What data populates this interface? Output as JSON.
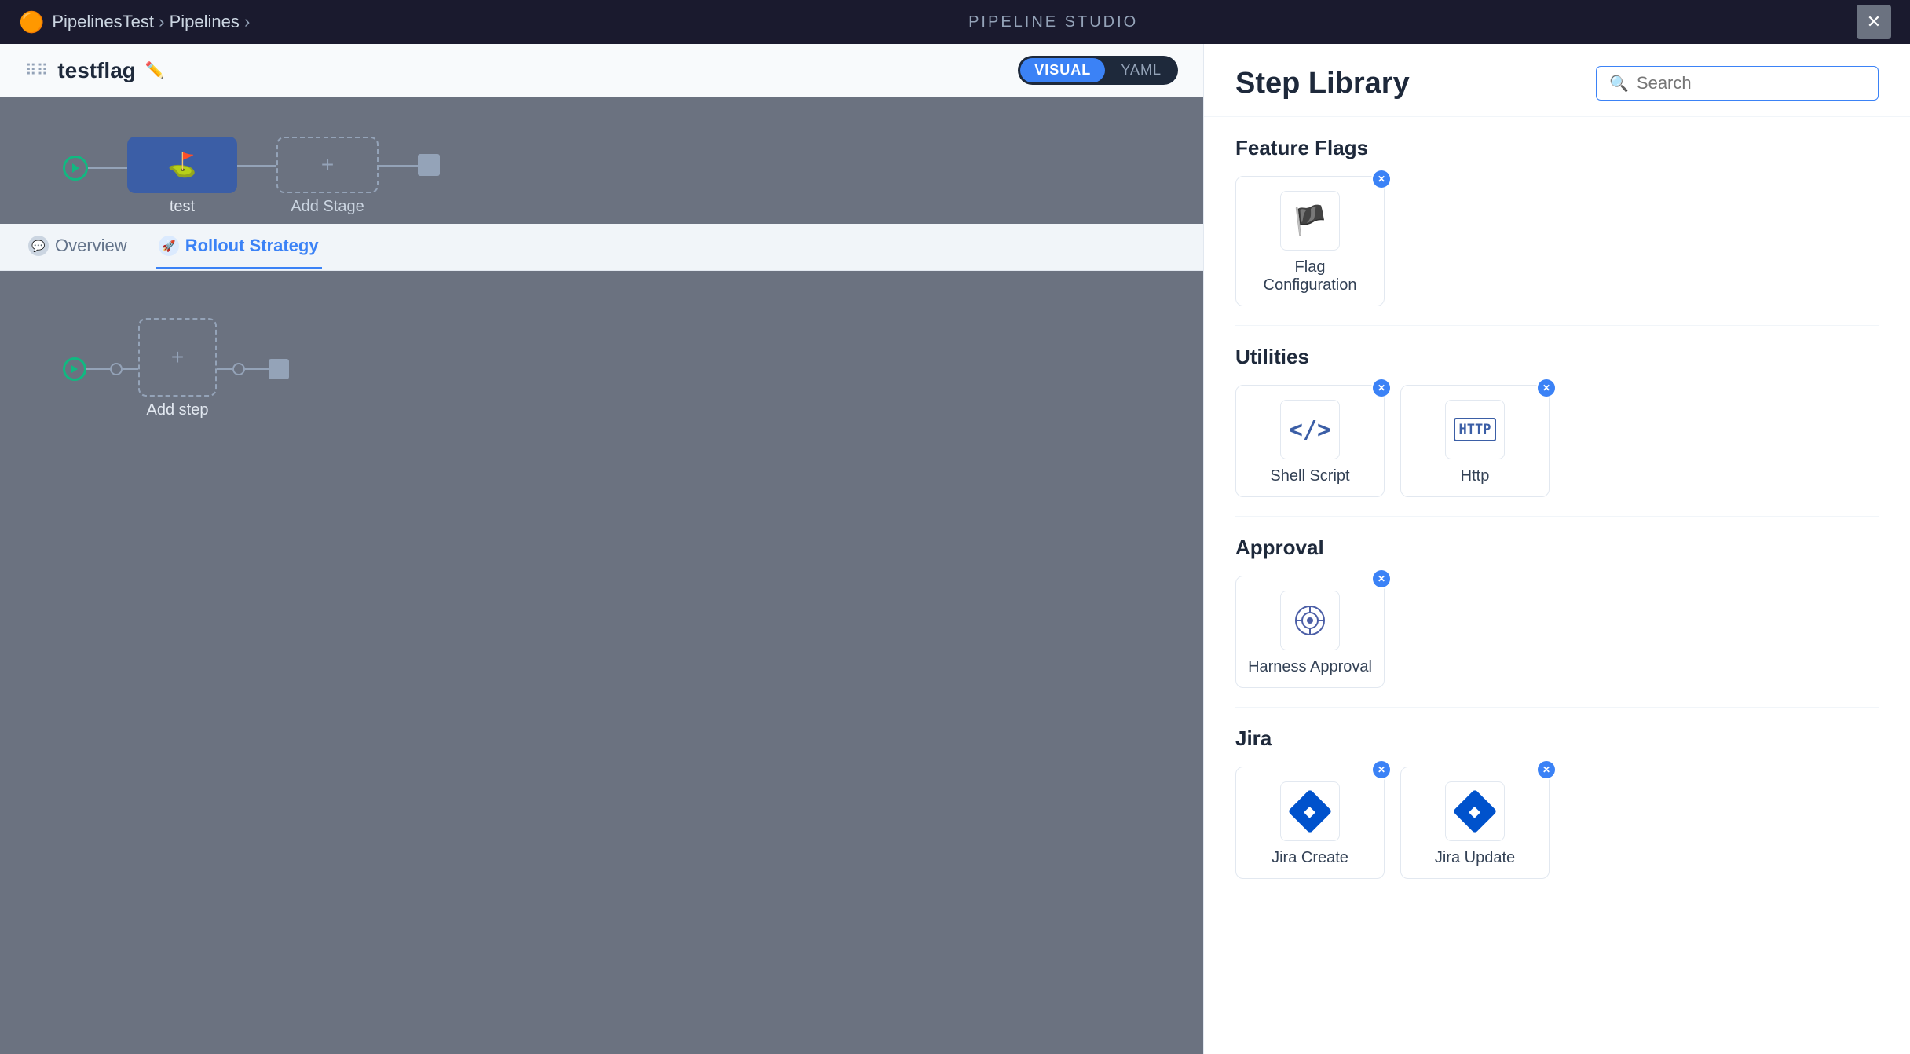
{
  "topbar": {
    "brand": "🟠",
    "breadcrumb1": "PipelinesTest",
    "breadcrumb2": "Pipelines",
    "center_label": "PIPELINE STUDIO",
    "close_label": "✕"
  },
  "pipeline": {
    "name": "testflag",
    "view_visual": "VISUAL",
    "view_yaml": "YAML",
    "stages": [
      {
        "id": "test",
        "label": "test"
      }
    ],
    "add_stage_label": "Add Stage"
  },
  "tabs": [
    {
      "id": "overview",
      "label": "Overview",
      "active": false
    },
    {
      "id": "rollout",
      "label": "Rollout Strategy",
      "active": true
    }
  ],
  "steps_section": {
    "add_step_label": "Add step"
  },
  "step_library": {
    "title": "Step Library",
    "search_placeholder": "Search",
    "categories": [
      {
        "id": "feature-flags",
        "label": "Feature Flags",
        "steps": [
          {
            "id": "flag-configuration",
            "label": "Flag Configuration",
            "icon": "flag"
          }
        ]
      },
      {
        "id": "utilities",
        "label": "Utilities",
        "steps": [
          {
            "id": "shell-script",
            "label": "Shell Script",
            "icon": "code"
          },
          {
            "id": "http",
            "label": "Http",
            "icon": "http"
          }
        ]
      },
      {
        "id": "approval",
        "label": "Approval",
        "steps": [
          {
            "id": "harness-approval",
            "label": "Harness Approval",
            "icon": "harness"
          }
        ]
      },
      {
        "id": "jira",
        "label": "Jira",
        "steps": [
          {
            "id": "jira-create",
            "label": "Jira Create",
            "icon": "jira"
          },
          {
            "id": "jira-update",
            "label": "Jira Update",
            "icon": "jira"
          }
        ]
      }
    ]
  }
}
